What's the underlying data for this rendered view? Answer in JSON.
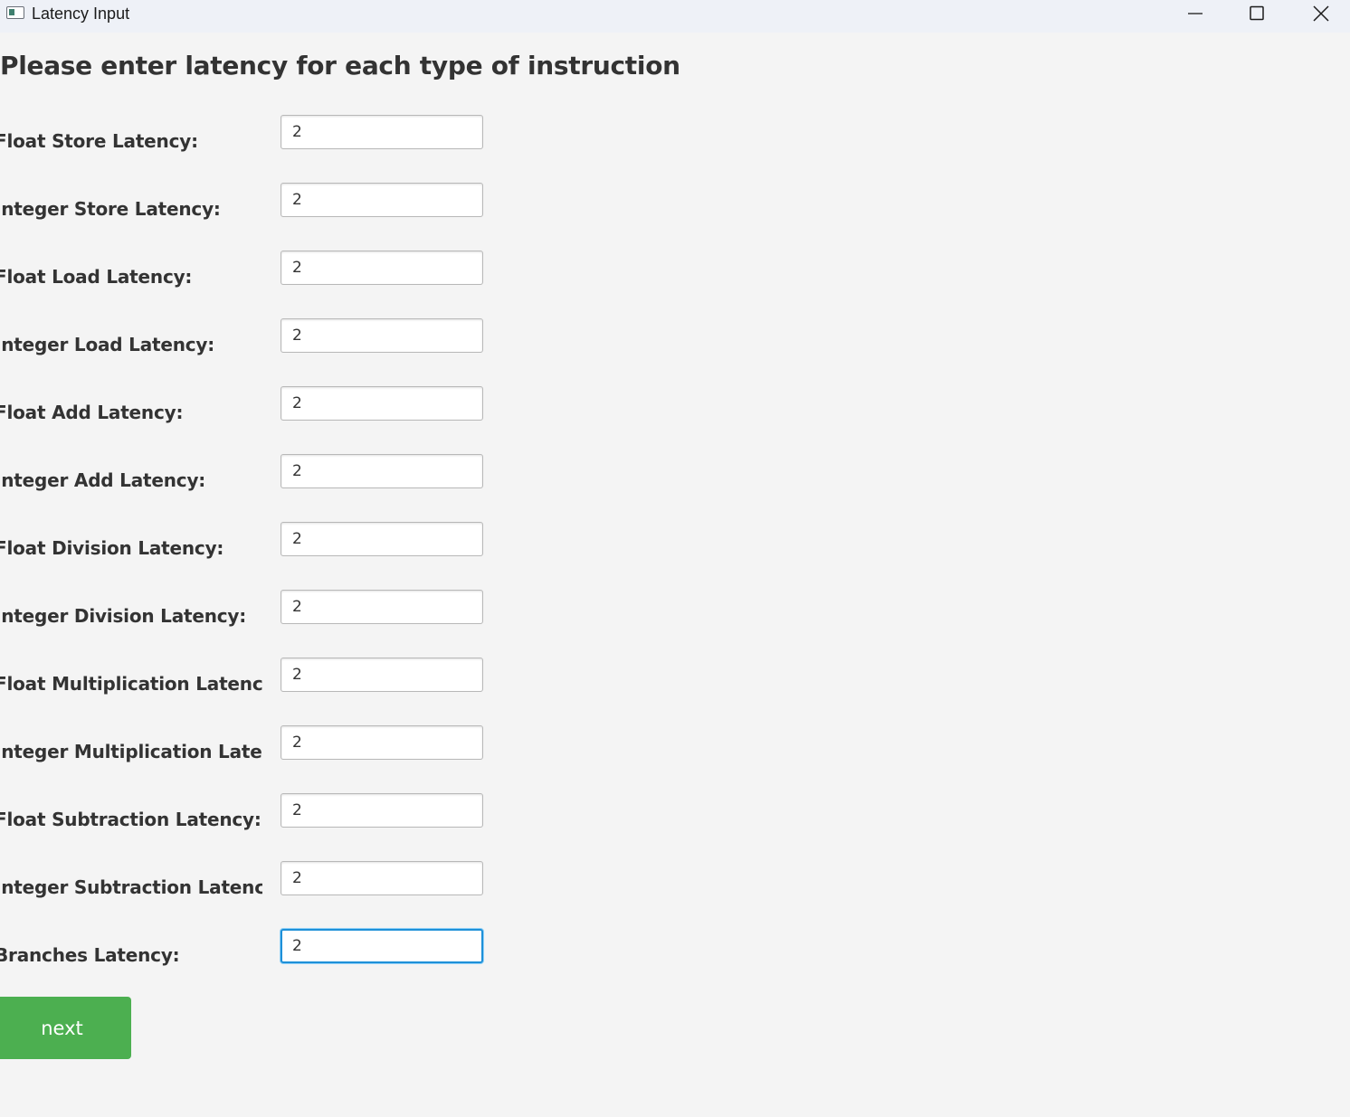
{
  "window": {
    "title": "Latency Input",
    "icon": "app-window-icon",
    "controls": [
      "minimize-icon",
      "maximize-icon",
      "close-icon"
    ]
  },
  "heading": "Please enter latency for each type of instruction",
  "fields": [
    {
      "label": "Float Store Latency:",
      "value": "2"
    },
    {
      "label": "Integer Store Latency:",
      "value": "2"
    },
    {
      "label": "Float Load Latency:",
      "value": "2"
    },
    {
      "label": "Integer Load Latency:",
      "value": "2"
    },
    {
      "label": "Float Add Latency:",
      "value": "2"
    },
    {
      "label": "Integer Add Latency:",
      "value": "2"
    },
    {
      "label": "Float Division Latency:",
      "value": "2"
    },
    {
      "label": "Integer Division Latency:",
      "value": "2"
    },
    {
      "label": "Float Multiplication Latency:",
      "value": "2"
    },
    {
      "label": "Integer Multiplication Laten...",
      "value": "2"
    },
    {
      "label": "Float Subtraction Latency:",
      "value": "2"
    },
    {
      "label": "Integer Subtraction Latency:",
      "value": "2"
    },
    {
      "label": "Branches Latency:",
      "value": "2"
    }
  ],
  "next_button": {
    "label": "next"
  },
  "colors": {
    "accent_button": "#4caf50",
    "focus_ring": "#1e90d8",
    "background": "#f4f4f4",
    "titlebar": "#eef1f7"
  }
}
